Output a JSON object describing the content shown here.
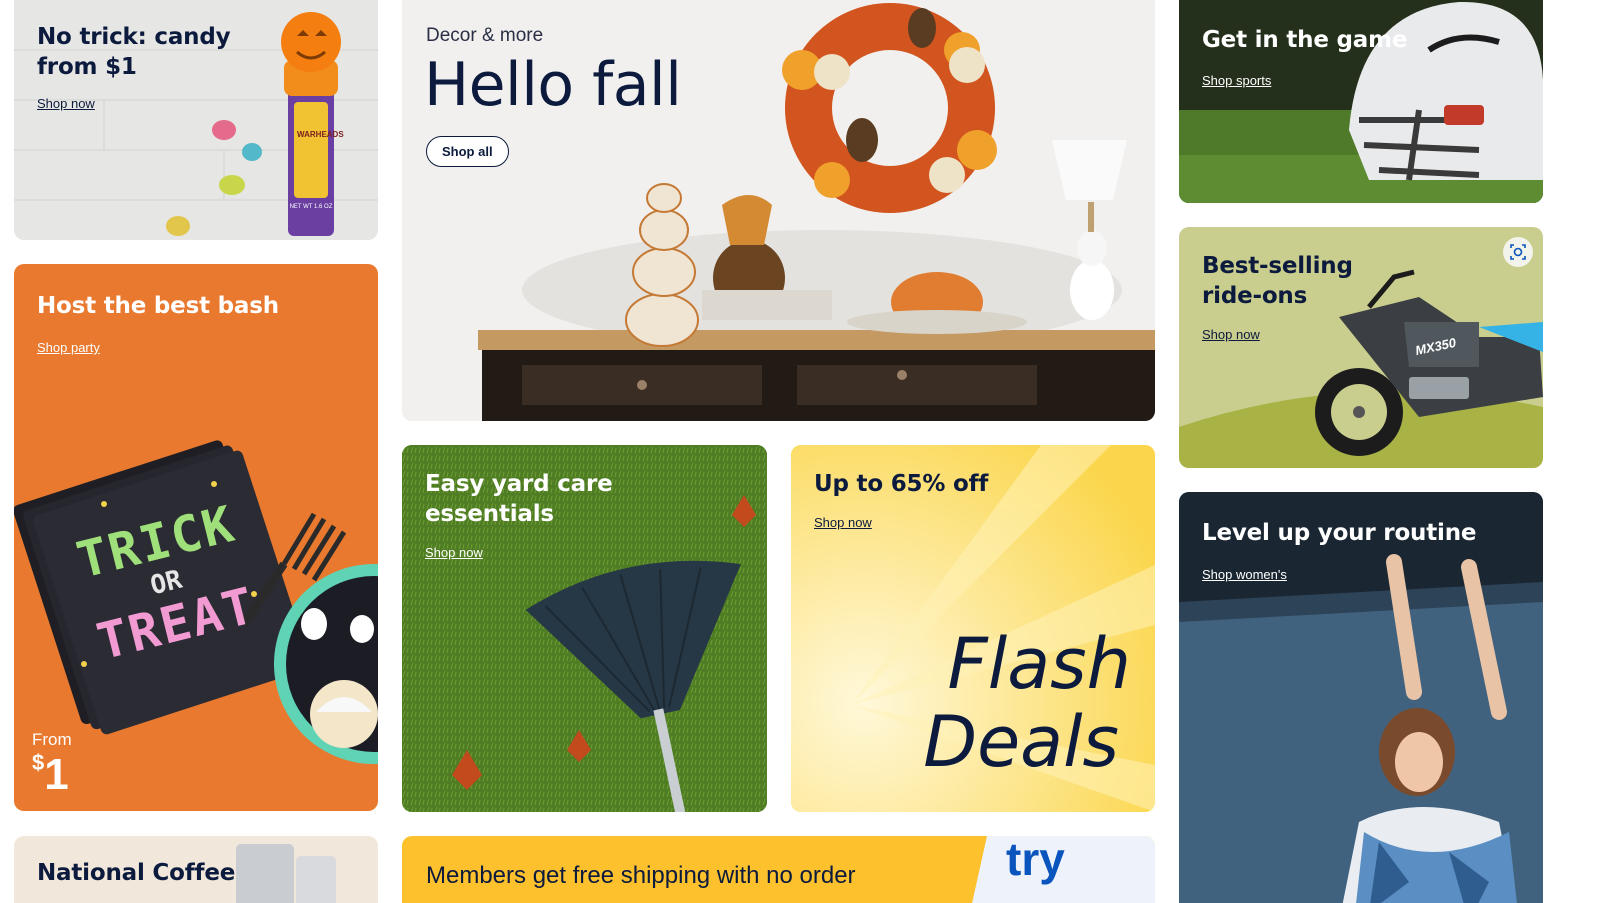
{
  "candy": {
    "title": "No trick: candy from $1",
    "link": "Shop now",
    "jar_brand": "WARHEADS",
    "jar_weight": "NET WT 1.6 OZ"
  },
  "bash": {
    "title": "Host the best bash",
    "link": "Shop party",
    "from_label": "From",
    "price_symbol": "$",
    "price_value": "1",
    "napkin_line1": "TRICK",
    "napkin_line2": "OR",
    "napkin_line3": "TREAT"
  },
  "fall": {
    "eyebrow": "Decor & more",
    "title": "Hello fall",
    "button": "Shop all"
  },
  "game": {
    "title": "Get in the game",
    "link": "Shop sports"
  },
  "rideons": {
    "title": "Best-selling ride-ons",
    "link": "Shop now",
    "bike_model": "MX350"
  },
  "yard": {
    "title": "Easy yard care essentials",
    "link": "Shop now"
  },
  "flash": {
    "title": "Up to 65% off",
    "link": "Shop now",
    "line1": "Flash",
    "line2": "Deals"
  },
  "routine": {
    "title": "Level up your routine",
    "link": "Shop women's"
  },
  "coffee": {
    "title": "National Coffee"
  },
  "members": {
    "title": "Members get free shipping with no order",
    "logo_text": "try"
  },
  "colors": {
    "bash_bg": "#e8792e",
    "flash_bg": "#fde37a",
    "members_bg": "#fcc12c",
    "rideons_bg": "#c9cd8d",
    "navy": "#0b1a3d"
  }
}
